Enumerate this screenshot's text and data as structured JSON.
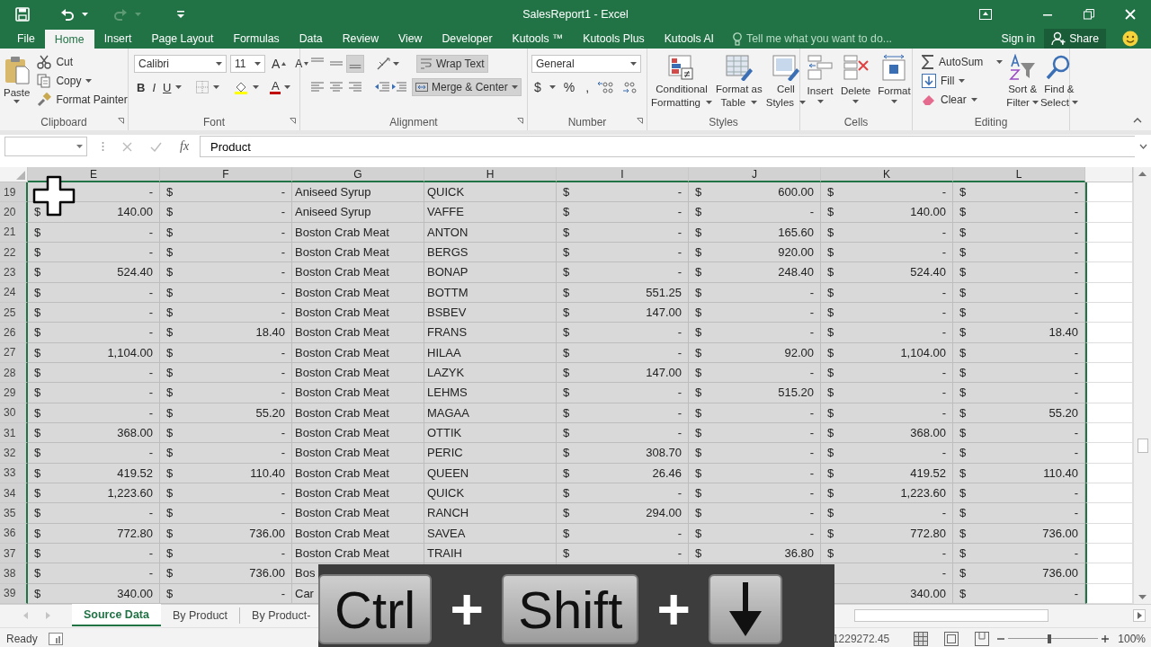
{
  "window": {
    "title": "SalesReport1 - Excel"
  },
  "quick_access": {
    "redo_disabled": true
  },
  "tabs": [
    {
      "label": "File",
      "selected": false
    },
    {
      "label": "Home",
      "selected": true
    },
    {
      "label": "Insert",
      "selected": false
    },
    {
      "label": "Page Layout",
      "selected": false
    },
    {
      "label": "Formulas",
      "selected": false
    },
    {
      "label": "Data",
      "selected": false
    },
    {
      "label": "Review",
      "selected": false
    },
    {
      "label": "View",
      "selected": false
    },
    {
      "label": "Developer",
      "selected": false
    },
    {
      "label": "Kutools ™",
      "selected": false
    },
    {
      "label": "Kutools Plus",
      "selected": false
    },
    {
      "label": "Kutools AI",
      "selected": false
    }
  ],
  "tell_me": {
    "placeholder": "Tell me what you want to do..."
  },
  "account": {
    "sign_in": "Sign in",
    "share": "Share"
  },
  "ribbon": {
    "clipboard": {
      "label": "Clipboard",
      "paste": "Paste",
      "items": [
        "Cut",
        "Copy",
        "Format Painter"
      ]
    },
    "font": {
      "label": "Font",
      "name": "Calibri",
      "size": "11",
      "grow": "A",
      "shrink": "A",
      "styles": [
        "B",
        "I",
        "U"
      ],
      "font_color": "A"
    },
    "alignment": {
      "label": "Alignment",
      "vertical": [
        {
          "selected": false
        },
        {
          "selected": false
        },
        {
          "selected": true
        }
      ],
      "wrap_text": {
        "label": "Wrap Text",
        "on": true
      },
      "merge": {
        "label": "Merge & Center",
        "on": true
      }
    },
    "number": {
      "label": "Number",
      "format": "General",
      "symbols": [
        "$",
        "%",
        ","
      ]
    },
    "styles": {
      "label": "Styles",
      "buttons": [
        {
          "lines": [
            "Conditional",
            "Formatting"
          ]
        },
        {
          "lines": [
            "Format as",
            "Table"
          ]
        },
        {
          "lines": [
            "Cell",
            "Styles"
          ]
        }
      ]
    },
    "cells": {
      "label": "Cells",
      "buttons": [
        "Insert",
        "Delete",
        "Format"
      ]
    },
    "editing": {
      "label": "Editing",
      "items": [
        "AutoSum",
        "Fill",
        "Clear"
      ],
      "buttons": [
        {
          "lines": [
            "Sort &",
            "Filter"
          ]
        },
        {
          "lines": [
            "Find &",
            "Select"
          ]
        }
      ]
    }
  },
  "formula_bar": {
    "function_label": "fx",
    "value": "Product"
  },
  "grid": {
    "columns": [
      {
        "label": "E",
        "selected": true
      },
      {
        "label": "F",
        "selected": true
      },
      {
        "label": "G",
        "selected": true
      },
      {
        "label": "H",
        "selected": true
      },
      {
        "label": "I",
        "selected": true
      },
      {
        "label": "J",
        "selected": true
      },
      {
        "label": "K",
        "selected": true
      },
      {
        "label": "L",
        "selected": true
      }
    ],
    "rows": [
      {
        "n": "19",
        "cells": [
          {
            "amt": "-"
          },
          [
            "$",
            "-"
          ],
          "Aniseed Syrup",
          "QUICK",
          [
            "$",
            "-"
          ],
          [
            "$",
            "600.00"
          ],
          [
            "$",
            "-"
          ],
          [
            "$",
            "-"
          ]
        ]
      },
      {
        "n": "20",
        "cells": [
          [
            "$",
            "140.00"
          ],
          [
            "$",
            "-"
          ],
          "Aniseed Syrup",
          "VAFFE",
          [
            "$",
            "-"
          ],
          [
            "$",
            "-"
          ],
          [
            "$",
            "140.00"
          ],
          [
            "$",
            "-"
          ]
        ]
      },
      {
        "n": "21",
        "cells": [
          [
            "$",
            "-"
          ],
          [
            "$",
            "-"
          ],
          "Boston Crab Meat",
          "ANTON",
          [
            "$",
            "-"
          ],
          [
            "$",
            "165.60"
          ],
          [
            "$",
            "-"
          ],
          [
            "$",
            "-"
          ]
        ]
      },
      {
        "n": "22",
        "cells": [
          [
            "$",
            "-"
          ],
          [
            "$",
            "-"
          ],
          "Boston Crab Meat",
          "BERGS",
          [
            "$",
            "-"
          ],
          [
            "$",
            "920.00"
          ],
          [
            "$",
            "-"
          ],
          [
            "$",
            "-"
          ]
        ]
      },
      {
        "n": "23",
        "cells": [
          [
            "$",
            "524.40"
          ],
          [
            "$",
            "-"
          ],
          "Boston Crab Meat",
          "BONAP",
          [
            "$",
            "-"
          ],
          [
            "$",
            "248.40"
          ],
          [
            "$",
            "524.40"
          ],
          [
            "$",
            "-"
          ]
        ]
      },
      {
        "n": "24",
        "cells": [
          [
            "$",
            "-"
          ],
          [
            "$",
            "-"
          ],
          "Boston Crab Meat",
          "BOTTM",
          [
            "$",
            "551.25"
          ],
          [
            "$",
            "-"
          ],
          [
            "$",
            "-"
          ],
          [
            "$",
            "-"
          ]
        ]
      },
      {
        "n": "25",
        "cells": [
          [
            "$",
            "-"
          ],
          [
            "$",
            "-"
          ],
          "Boston Crab Meat",
          "BSBEV",
          [
            "$",
            "147.00"
          ],
          [
            "$",
            "-"
          ],
          [
            "$",
            "-"
          ],
          [
            "$",
            "-"
          ]
        ]
      },
      {
        "n": "26",
        "cells": [
          [
            "$",
            "-"
          ],
          [
            "$",
            "18.40"
          ],
          "Boston Crab Meat",
          "FRANS",
          [
            "$",
            "-"
          ],
          [
            "$",
            "-"
          ],
          [
            "$",
            "-"
          ],
          [
            "$",
            "18.40"
          ]
        ]
      },
      {
        "n": "27",
        "cells": [
          [
            "$",
            "1,104.00"
          ],
          [
            "$",
            "-"
          ],
          "Boston Crab Meat",
          "HILAA",
          [
            "$",
            "-"
          ],
          [
            "$",
            "92.00"
          ],
          [
            "$",
            "1,104.00"
          ],
          [
            "$",
            "-"
          ]
        ]
      },
      {
        "n": "28",
        "cells": [
          [
            "$",
            "-"
          ],
          [
            "$",
            "-"
          ],
          "Boston Crab Meat",
          "LAZYK",
          [
            "$",
            "147.00"
          ],
          [
            "$",
            "-"
          ],
          [
            "$",
            "-"
          ],
          [
            "$",
            "-"
          ]
        ]
      },
      {
        "n": "29",
        "cells": [
          [
            "$",
            "-"
          ],
          [
            "$",
            "-"
          ],
          "Boston Crab Meat",
          "LEHMS",
          [
            "$",
            "-"
          ],
          [
            "$",
            "515.20"
          ],
          [
            "$",
            "-"
          ],
          [
            "$",
            "-"
          ]
        ]
      },
      {
        "n": "30",
        "cells": [
          [
            "$",
            "-"
          ],
          [
            "$",
            "55.20"
          ],
          "Boston Crab Meat",
          "MAGAA",
          [
            "$",
            "-"
          ],
          [
            "$",
            "-"
          ],
          [
            "$",
            "-"
          ],
          [
            "$",
            "55.20"
          ]
        ]
      },
      {
        "n": "31",
        "cells": [
          [
            "$",
            "368.00"
          ],
          [
            "$",
            "-"
          ],
          "Boston Crab Meat",
          "OTTIK",
          [
            "$",
            "-"
          ],
          [
            "$",
            "-"
          ],
          [
            "$",
            "368.00"
          ],
          [
            "$",
            "-"
          ]
        ]
      },
      {
        "n": "32",
        "cells": [
          [
            "$",
            "-"
          ],
          [
            "$",
            "-"
          ],
          "Boston Crab Meat",
          "PERIC",
          [
            "$",
            "308.70"
          ],
          [
            "$",
            "-"
          ],
          [
            "$",
            "-"
          ],
          [
            "$",
            "-"
          ]
        ]
      },
      {
        "n": "33",
        "cells": [
          [
            "$",
            "419.52"
          ],
          [
            "$",
            "110.40"
          ],
          "Boston Crab Meat",
          "QUEEN",
          [
            "$",
            "26.46"
          ],
          [
            "$",
            "-"
          ],
          [
            "$",
            "419.52"
          ],
          [
            "$",
            "110.40"
          ]
        ]
      },
      {
        "n": "34",
        "cells": [
          [
            "$",
            "1,223.60"
          ],
          [
            "$",
            "-"
          ],
          "Boston Crab Meat",
          "QUICK",
          [
            "$",
            "-"
          ],
          [
            "$",
            "-"
          ],
          [
            "$",
            "1,223.60"
          ],
          [
            "$",
            "-"
          ]
        ]
      },
      {
        "n": "35",
        "cells": [
          [
            "$",
            "-"
          ],
          [
            "$",
            "-"
          ],
          "Boston Crab Meat",
          "RANCH",
          [
            "$",
            "294.00"
          ],
          [
            "$",
            "-"
          ],
          [
            "$",
            "-"
          ],
          [
            "$",
            "-"
          ]
        ]
      },
      {
        "n": "36",
        "cells": [
          [
            "$",
            "772.80"
          ],
          [
            "$",
            "736.00"
          ],
          "Boston Crab Meat",
          "SAVEA",
          [
            "$",
            "-"
          ],
          [
            "$",
            "-"
          ],
          [
            "$",
            "772.80"
          ],
          [
            "$",
            "736.00"
          ]
        ]
      },
      {
        "n": "37",
        "cells": [
          [
            "$",
            "-"
          ],
          [
            "$",
            "-"
          ],
          "Boston Crab Meat",
          "TRAIH",
          [
            "$",
            "-"
          ],
          [
            "$",
            "36.80"
          ],
          [
            "$",
            "-"
          ],
          [
            "$",
            "-"
          ]
        ]
      },
      {
        "n": "38",
        "cells": [
          [
            "$",
            "-"
          ],
          [
            "$",
            "736.00"
          ],
          "Bos",
          null,
          null,
          null,
          {
            "amt": "-"
          },
          [
            "$",
            "736.00"
          ]
        ]
      },
      {
        "n": "39",
        "cells": [
          [
            "$",
            "340.00"
          ],
          [
            "$",
            "-"
          ],
          "Car",
          null,
          null,
          null,
          {
            "amt": "340.00"
          },
          [
            "$",
            "-"
          ]
        ]
      }
    ]
  },
  "sheet_tabs": [
    {
      "label": "Source Data",
      "selected": true
    },
    {
      "label": "By Product",
      "selected": false
    },
    {
      "label": "By Product-",
      "selected": false
    }
  ],
  "status_bar": {
    "mode": "Ready",
    "sum": "1229272.45",
    "zoom": "100%",
    "zoom_slider": {
      "level": 0.46
    }
  },
  "keystroke_overlay": {
    "keys": [
      {
        "kind": "key",
        "label": "Ctrl"
      },
      {
        "kind": "plus",
        "label": "+"
      },
      {
        "kind": "key",
        "label": "Shift"
      },
      {
        "kind": "plus",
        "label": "+"
      },
      {
        "kind": "arrow_key"
      }
    ]
  }
}
